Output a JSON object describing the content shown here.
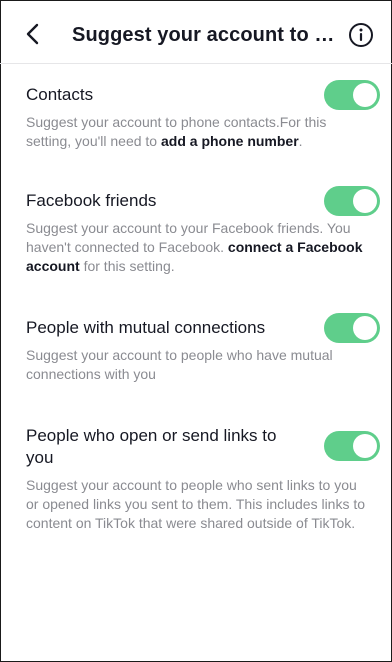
{
  "header": {
    "title": "Suggest your account to o..."
  },
  "settings": [
    {
      "title": "Contacts",
      "desc_pre": "Suggest your account to phone contacts.For this setting, you'll need to ",
      "desc_link": "add a phone number",
      "desc_post": ".",
      "enabled": true
    },
    {
      "title": "Facebook friends",
      "desc_pre": "Suggest your account to your Facebook friends. You haven't connected to Facebook. ",
      "desc_link": "connect a Facebook account",
      "desc_post": " for this setting.",
      "enabled": true
    },
    {
      "title": "People with mutual connections",
      "desc_pre": "Suggest your account to people who have mutual connections with you",
      "desc_link": "",
      "desc_post": "",
      "enabled": true
    },
    {
      "title": "People who open or send links to you",
      "desc_pre": "Suggest your account to people who sent links to you or opened links you sent to them. This includes links to content on TikTok that were shared outside of TikTok.",
      "desc_link": "",
      "desc_post": "",
      "enabled": true
    }
  ],
  "colors": {
    "toggle_on": "#5fce8b",
    "text_primary": "#161823",
    "text_secondary": "#8a8b91"
  },
  "icons": {
    "back": "chevron-left-icon",
    "info": "info-icon"
  }
}
